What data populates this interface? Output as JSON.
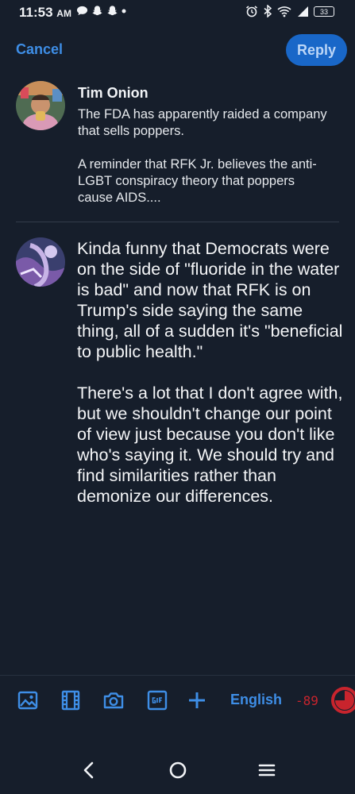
{
  "status_bar": {
    "time": "11:53",
    "ampm": "AM",
    "battery": "33"
  },
  "top_bar": {
    "cancel_label": "Cancel",
    "reply_label": "Reply"
  },
  "parent_post": {
    "author": "Tim Onion",
    "paragraphs": [
      "The FDA has apparently raided a company that sells poppers.",
      "A reminder that RFK Jr. believes the anti-LGBT conspiracy theory that poppers cause AIDS...."
    ]
  },
  "reply_draft": {
    "paragraphs": [
      "Kinda funny that Democrats were on the side of \"fluoride in the water is bad\" and now that RFK is on Trump's side saying the same thing, all of a sudden it's \"beneficial to public health.\"",
      "There's a lot that I don't agree with, but we shouldn't change our point of view just because you don't like who's saying it. We should try and find similarities rather than demonize our differences."
    ]
  },
  "toolbar": {
    "icons": [
      "image-icon",
      "video-icon",
      "camera-icon",
      "gif-icon",
      "plus-icon"
    ],
    "language_label": "English",
    "char_count": "-89",
    "accent_color": "#3e8ee6",
    "over_limit_color": "#c8242d"
  }
}
